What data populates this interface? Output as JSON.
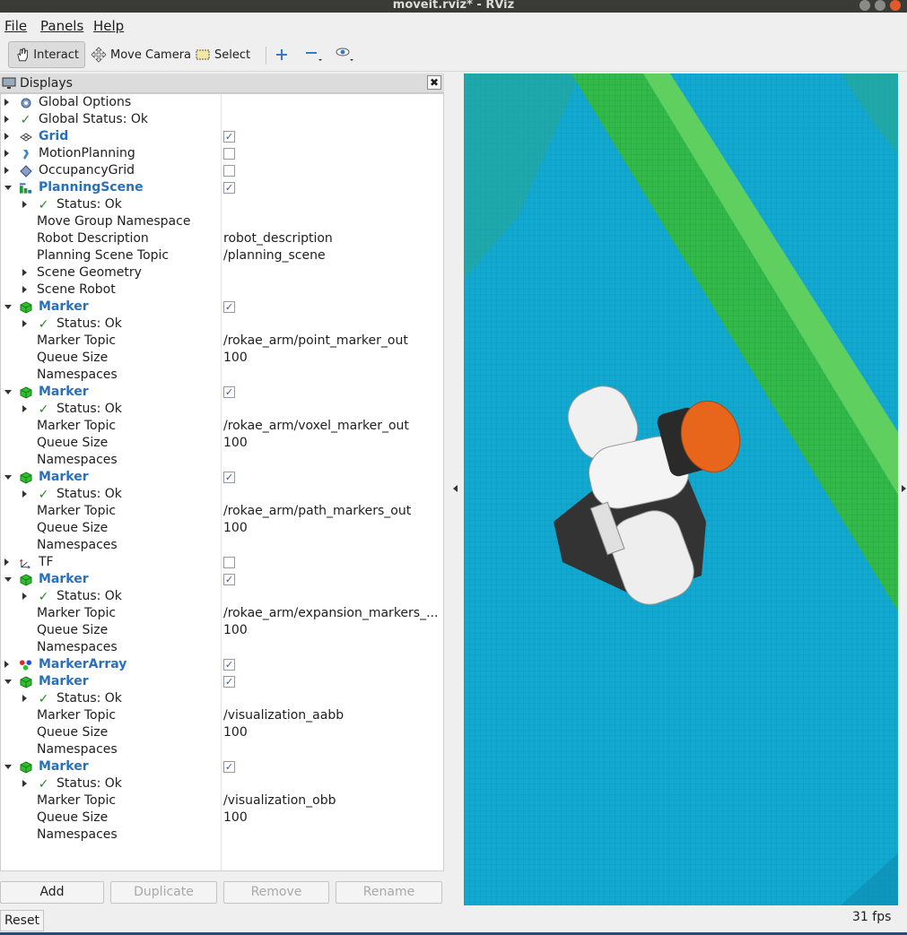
{
  "window": {
    "title": "moveit.rviz* - RViz"
  },
  "menu": {
    "file": "File",
    "panels": "Panels",
    "help": "Help"
  },
  "toolbar": {
    "interact": "Interact",
    "move_camera": "Move Camera",
    "select": "Select"
  },
  "displays_panel": {
    "title": "Displays",
    "rows": [
      {
        "name": "Global Options",
        "value": "",
        "checkbox": null,
        "indent": 0,
        "expand": "r",
        "icon": "gear-icon",
        "blue": false
      },
      {
        "name": "Global Status: Ok",
        "value": "",
        "checkbox": null,
        "indent": 0,
        "expand": "r",
        "icon": "check-icon",
        "blue": false
      },
      {
        "name": "Grid",
        "value": "",
        "checkbox": true,
        "indent": 0,
        "expand": "r",
        "icon": "grid-icon",
        "blue": true
      },
      {
        "name": "MotionPlanning",
        "value": "",
        "checkbox": false,
        "indent": 0,
        "expand": "r",
        "icon": "motion-planning-icon",
        "blue": false
      },
      {
        "name": "OccupancyGrid",
        "value": "",
        "checkbox": false,
        "indent": 0,
        "expand": "r",
        "icon": "occupancy-grid-icon",
        "blue": false
      },
      {
        "name": "PlanningScene",
        "value": "",
        "checkbox": true,
        "indent": 0,
        "expand": "d",
        "icon": "planning-scene-icon",
        "blue": true
      },
      {
        "name": "Status: Ok",
        "value": "",
        "checkbox": null,
        "indent": 1,
        "expand": "r",
        "icon": "check-icon",
        "blue": false
      },
      {
        "name": "Move Group Namespace",
        "value": "",
        "checkbox": null,
        "indent": 2,
        "expand": "",
        "icon": "",
        "blue": false
      },
      {
        "name": "Robot Description",
        "value": "robot_description",
        "checkbox": null,
        "indent": 2,
        "expand": "",
        "icon": "",
        "blue": false
      },
      {
        "name": "Planning Scene Topic",
        "value": "/planning_scene",
        "checkbox": null,
        "indent": 2,
        "expand": "",
        "icon": "",
        "blue": false
      },
      {
        "name": "Scene Geometry",
        "value": "",
        "checkbox": null,
        "indent": 2,
        "expand": "r",
        "icon": "",
        "blue": false
      },
      {
        "name": "Scene Robot",
        "value": "",
        "checkbox": null,
        "indent": 2,
        "expand": "r",
        "icon": "",
        "blue": false
      },
      {
        "name": "Marker",
        "value": "",
        "checkbox": true,
        "indent": 0,
        "expand": "d",
        "icon": "marker-icon",
        "blue": true
      },
      {
        "name": "Status: Ok",
        "value": "",
        "checkbox": null,
        "indent": 1,
        "expand": "r",
        "icon": "check-icon",
        "blue": false
      },
      {
        "name": "Marker Topic",
        "value": "/rokae_arm/point_marker_out",
        "checkbox": null,
        "indent": 2,
        "expand": "",
        "icon": "",
        "blue": false
      },
      {
        "name": "Queue Size",
        "value": "100",
        "checkbox": null,
        "indent": 2,
        "expand": "",
        "icon": "",
        "blue": false
      },
      {
        "name": "Namespaces",
        "value": "",
        "checkbox": null,
        "indent": 2,
        "expand": "",
        "icon": "",
        "blue": false
      },
      {
        "name": "Marker",
        "value": "",
        "checkbox": true,
        "indent": 0,
        "expand": "d",
        "icon": "marker-icon",
        "blue": true
      },
      {
        "name": "Status: Ok",
        "value": "",
        "checkbox": null,
        "indent": 1,
        "expand": "r",
        "icon": "check-icon",
        "blue": false
      },
      {
        "name": "Marker Topic",
        "value": "/rokae_arm/voxel_marker_out",
        "checkbox": null,
        "indent": 2,
        "expand": "",
        "icon": "",
        "blue": false
      },
      {
        "name": "Queue Size",
        "value": "100",
        "checkbox": null,
        "indent": 2,
        "expand": "",
        "icon": "",
        "blue": false
      },
      {
        "name": "Namespaces",
        "value": "",
        "checkbox": null,
        "indent": 2,
        "expand": "",
        "icon": "",
        "blue": false
      },
      {
        "name": "Marker",
        "value": "",
        "checkbox": true,
        "indent": 0,
        "expand": "d",
        "icon": "marker-icon",
        "blue": true
      },
      {
        "name": "Status: Ok",
        "value": "",
        "checkbox": null,
        "indent": 1,
        "expand": "r",
        "icon": "check-icon",
        "blue": false
      },
      {
        "name": "Marker Topic",
        "value": "/rokae_arm/path_markers_out",
        "checkbox": null,
        "indent": 2,
        "expand": "",
        "icon": "",
        "blue": false
      },
      {
        "name": "Queue Size",
        "value": "100",
        "checkbox": null,
        "indent": 2,
        "expand": "",
        "icon": "",
        "blue": false
      },
      {
        "name": "Namespaces",
        "value": "",
        "checkbox": null,
        "indent": 2,
        "expand": "",
        "icon": "",
        "blue": false
      },
      {
        "name": "TF",
        "value": "",
        "checkbox": false,
        "indent": 0,
        "expand": "r",
        "icon": "tf-icon",
        "blue": false
      },
      {
        "name": "Marker",
        "value": "",
        "checkbox": true,
        "indent": 0,
        "expand": "d",
        "icon": "marker-icon",
        "blue": true
      },
      {
        "name": "Status: Ok",
        "value": "",
        "checkbox": null,
        "indent": 1,
        "expand": "r",
        "icon": "check-icon",
        "blue": false
      },
      {
        "name": "Marker Topic",
        "value": "/rokae_arm/expansion_markers_...",
        "checkbox": null,
        "indent": 2,
        "expand": "",
        "icon": "",
        "blue": false
      },
      {
        "name": "Queue Size",
        "value": "100",
        "checkbox": null,
        "indent": 2,
        "expand": "",
        "icon": "",
        "blue": false
      },
      {
        "name": "Namespaces",
        "value": "",
        "checkbox": null,
        "indent": 2,
        "expand": "",
        "icon": "",
        "blue": false
      },
      {
        "name": "MarkerArray",
        "value": "",
        "checkbox": true,
        "indent": 0,
        "expand": "r",
        "icon": "marker-array-icon",
        "blue": true
      },
      {
        "name": "Marker",
        "value": "",
        "checkbox": true,
        "indent": 0,
        "expand": "d",
        "icon": "marker-icon",
        "blue": true
      },
      {
        "name": "Status: Ok",
        "value": "",
        "checkbox": null,
        "indent": 1,
        "expand": "r",
        "icon": "check-icon",
        "blue": false
      },
      {
        "name": "Marker Topic",
        "value": "/visualization_aabb",
        "checkbox": null,
        "indent": 2,
        "expand": "",
        "icon": "",
        "blue": false
      },
      {
        "name": "Queue Size",
        "value": "100",
        "checkbox": null,
        "indent": 2,
        "expand": "",
        "icon": "",
        "blue": false
      },
      {
        "name": "Namespaces",
        "value": "",
        "checkbox": null,
        "indent": 2,
        "expand": "",
        "icon": "",
        "blue": false
      },
      {
        "name": "Marker",
        "value": "",
        "checkbox": true,
        "indent": 0,
        "expand": "d",
        "icon": "marker-icon",
        "blue": true
      },
      {
        "name": "Status: Ok",
        "value": "",
        "checkbox": null,
        "indent": 1,
        "expand": "r",
        "icon": "check-icon",
        "blue": false
      },
      {
        "name": "Marker Topic",
        "value": "/visualization_obb",
        "checkbox": null,
        "indent": 2,
        "expand": "",
        "icon": "",
        "blue": false
      },
      {
        "name": "Queue Size",
        "value": "100",
        "checkbox": null,
        "indent": 2,
        "expand": "",
        "icon": "",
        "blue": false
      },
      {
        "name": "Namespaces",
        "value": "",
        "checkbox": null,
        "indent": 2,
        "expand": "",
        "icon": "",
        "blue": false
      }
    ]
  },
  "buttons": {
    "add": "Add",
    "duplicate": "Duplicate",
    "remove": "Remove",
    "rename": "Rename",
    "reset": "Reset"
  },
  "status": {
    "fps": "31 fps"
  },
  "colors": {
    "accent_blue": "#2a6fba",
    "floor_cyan": "#12a8cf",
    "wall_green": "#3cc83c",
    "end_effector_orange": "#e8661c"
  }
}
